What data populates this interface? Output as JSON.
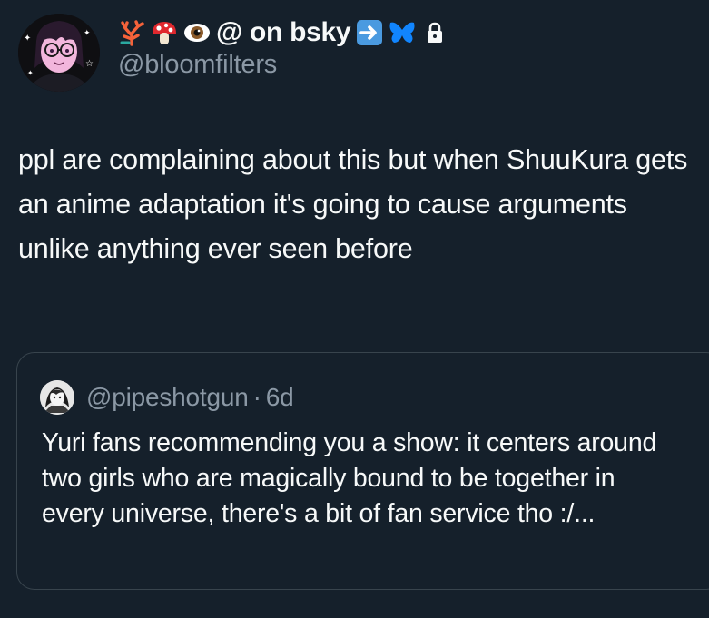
{
  "author": {
    "name_emojis": [
      "coral-emoji",
      "mushroom-emoji",
      "eye-emoji"
    ],
    "display_name": "@ on bsky",
    "name_suffix_emojis": [
      "right-arrow-emoji",
      "butterfly-emoji"
    ],
    "protected_icon": "lock-icon",
    "handle": "@bloomfilters"
  },
  "tweet_text": "ppl are complaining about this but when ShuuKura gets an anime adaptation it's going to cause arguments unlike anything ever seen before",
  "quote": {
    "handle": "@pipeshotgun",
    "separator": "·",
    "time": "6d",
    "text": "Yuri fans recommending you a show: it centers around two girls who are magically bound to be together in every universe, there's a bit of fan service tho :/..."
  },
  "colors": {
    "background": "#15202b",
    "primary_text": "#f7f9f9",
    "secondary_text": "#8b98a5",
    "border": "#38444d",
    "bsky_blue": "#1185fe"
  }
}
